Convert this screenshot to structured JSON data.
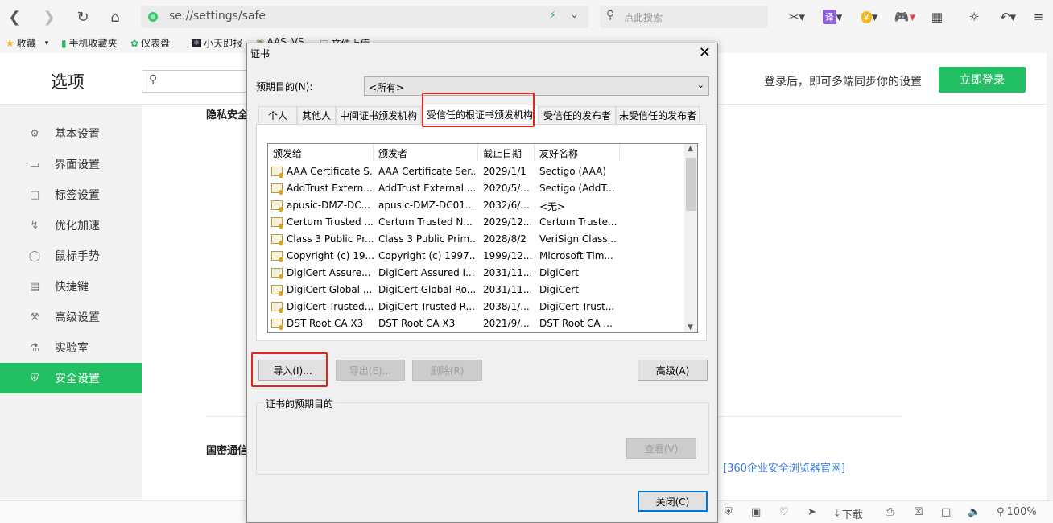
{
  "browser": {
    "url": "se://settings/safe",
    "search_placeholder": "点此搜索",
    "zoom": "100%",
    "download_label": "下载"
  },
  "bookmarks": [
    "收藏",
    "手机收藏夹",
    "仪表盘",
    "小天即报",
    "AAS_VS",
    "文件上传"
  ],
  "page": {
    "title": "选项",
    "login_hint": "登录后，即可多端同步你的设置",
    "login_button": "立即登录",
    "section_privacy": "隐私安全",
    "section_gm": "国密通信",
    "link_text": "[360企业安全浏览器官网]"
  },
  "sidebar": {
    "items": [
      {
        "label": "基本设置",
        "icon": "settings-icon"
      },
      {
        "label": "界面设置",
        "icon": "window-icon"
      },
      {
        "label": "标签设置",
        "icon": "tab-icon"
      },
      {
        "label": "优化加速",
        "icon": "bolt-icon"
      },
      {
        "label": "鼠标手势",
        "icon": "mouse-icon"
      },
      {
        "label": "快捷键",
        "icon": "keyboard-icon"
      },
      {
        "label": "高级设置",
        "icon": "wrench-icon"
      },
      {
        "label": "实验室",
        "icon": "flask-icon"
      },
      {
        "label": "安全设置",
        "icon": "shield-icon"
      }
    ],
    "active": "安全设置"
  },
  "dialog": {
    "title": "证书",
    "purpose_label": "预期目的(N):",
    "purpose_value": "<所有>",
    "tabs": [
      "个人",
      "其他人",
      "中间证书颁发机构",
      "受信任的根证书颁发机构",
      "受信任的发布者",
      "未受信任的发布者"
    ],
    "active_tab": "受信任的根证书颁发机构",
    "columns": [
      "颁发给",
      "颁发者",
      "截止日期",
      "友好名称"
    ],
    "rows": [
      [
        "AAA Certificate S...",
        "AAA Certificate Ser...",
        "2029/1/1",
        "Sectigo (AAA)"
      ],
      [
        "AddTrust Extern...",
        "AddTrust External ...",
        "2020/5/...",
        "Sectigo (AddT..."
      ],
      [
        "apusic-DMZ-DC...",
        "apusic-DMZ-DC01...",
        "2032/6/...",
        "<无>"
      ],
      [
        "Certum Trusted ...",
        "Certum Trusted N...",
        "2029/12...",
        "Certum Truste..."
      ],
      [
        "Class 3 Public Pr...",
        "Class 3 Public Prim...",
        "2028/8/2",
        "VeriSign Class..."
      ],
      [
        "Copyright (c) 19...",
        "Copyright (c) 1997...",
        "1999/12...",
        "Microsoft Tim..."
      ],
      [
        "DigiCert Assure...",
        "DigiCert Assured I...",
        "2031/11...",
        "DigiCert"
      ],
      [
        "DigiCert Global ...",
        "DigiCert Global Ro...",
        "2031/11...",
        "DigiCert"
      ],
      [
        "DigiCert Trusted...",
        "DigiCert Trusted R...",
        "2038/1/...",
        "DigiCert Trust..."
      ],
      [
        "DST Root CA X3",
        "DST Root CA X3",
        "2021/9/...",
        "DST Root CA ..."
      ]
    ],
    "buttons": {
      "import": "导入(I)...",
      "export": "导出(E)...",
      "remove": "删除(R)",
      "advanced": "高级(A)",
      "view": "查看(V)",
      "close": "关闭(C)"
    },
    "cert_purpose_label": "证书的预期目的",
    "highlight_color": "#e8231b"
  }
}
